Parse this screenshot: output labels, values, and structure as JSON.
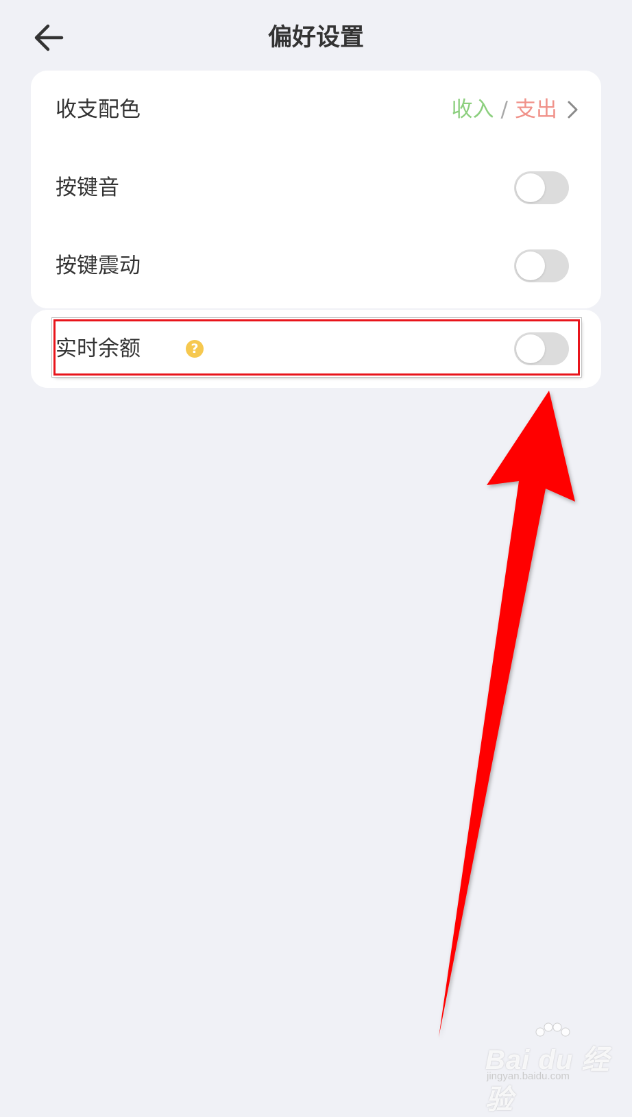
{
  "header": {
    "title": "偏好设置",
    "back_icon": "arrow-left-icon"
  },
  "settings": {
    "color_scheme": {
      "label": "收支配色",
      "income_label": "收入",
      "separator": "/",
      "expense_label": "支出",
      "income_color": "#8ccf7e",
      "expense_color": "#f0928a"
    },
    "key_sound": {
      "label": "按键音",
      "enabled": false
    },
    "key_vibration": {
      "label": "按键震动",
      "enabled": false
    },
    "realtime_balance": {
      "label": "实时余额",
      "help_glyph": "?",
      "enabled": false
    }
  },
  "annotation": {
    "highlight_color": "#e8141b",
    "arrow_color": "#ff0000"
  },
  "watermark": {
    "brand": "Bai du 经验",
    "url": "jingyan.baidu.com"
  }
}
